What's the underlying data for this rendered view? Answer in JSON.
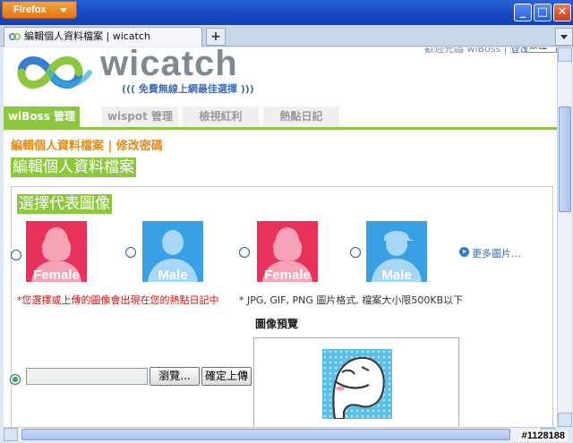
{
  "browser": {
    "menu_label": "Firefox",
    "tab_title": "編輯個人資料檔案 | wicatch",
    "new_tab": "+",
    "win_minimize": "_",
    "win_maximize": "□",
    "win_close": "✕"
  },
  "header": {
    "toplinks_text": "歡迎光臨 wiBoss | ",
    "logout_label": "登出",
    "language_select": "繁體",
    "logo_word": "wicatch",
    "slogan": "((( 免費無線上網最佳選擇 )))"
  },
  "nav": {
    "tabs": [
      {
        "label": "wiBoss 管理"
      },
      {
        "label": "wispot 管理"
      },
      {
        "label": "檢視紅利"
      },
      {
        "label": "熱點日記"
      }
    ]
  },
  "page": {
    "breadcrumb": "編輯個人資料檔案 | 修改密碼",
    "title": "編輯個人資料檔案",
    "section_title": "選擇代表圖像",
    "avatars": [
      {
        "caption": "Female",
        "color": "#e8325a"
      },
      {
        "caption": "Male",
        "color": "#3aa0e4"
      },
      {
        "caption": "Female",
        "color": "#e8325a"
      },
      {
        "caption": "Male",
        "color": "#3aa0e4"
      }
    ],
    "more_link": "更多圖片...",
    "note_red": "*您選擇或上傳的圖像會出現在您的熱點日記中",
    "note_gray": "* JPG, GIF, PNG 圖片格式, 檔案大小限500KB以下",
    "preview_label": "圖像預覽",
    "browse_button": "瀏覽...",
    "upload_button": "確定上傳"
  },
  "watermark": "#1128188",
  "colors": {
    "accent_green": "#8dc63f",
    "orange_text": "#e08a18",
    "female_pink": "#e8325a",
    "male_blue": "#3aa0e4"
  }
}
